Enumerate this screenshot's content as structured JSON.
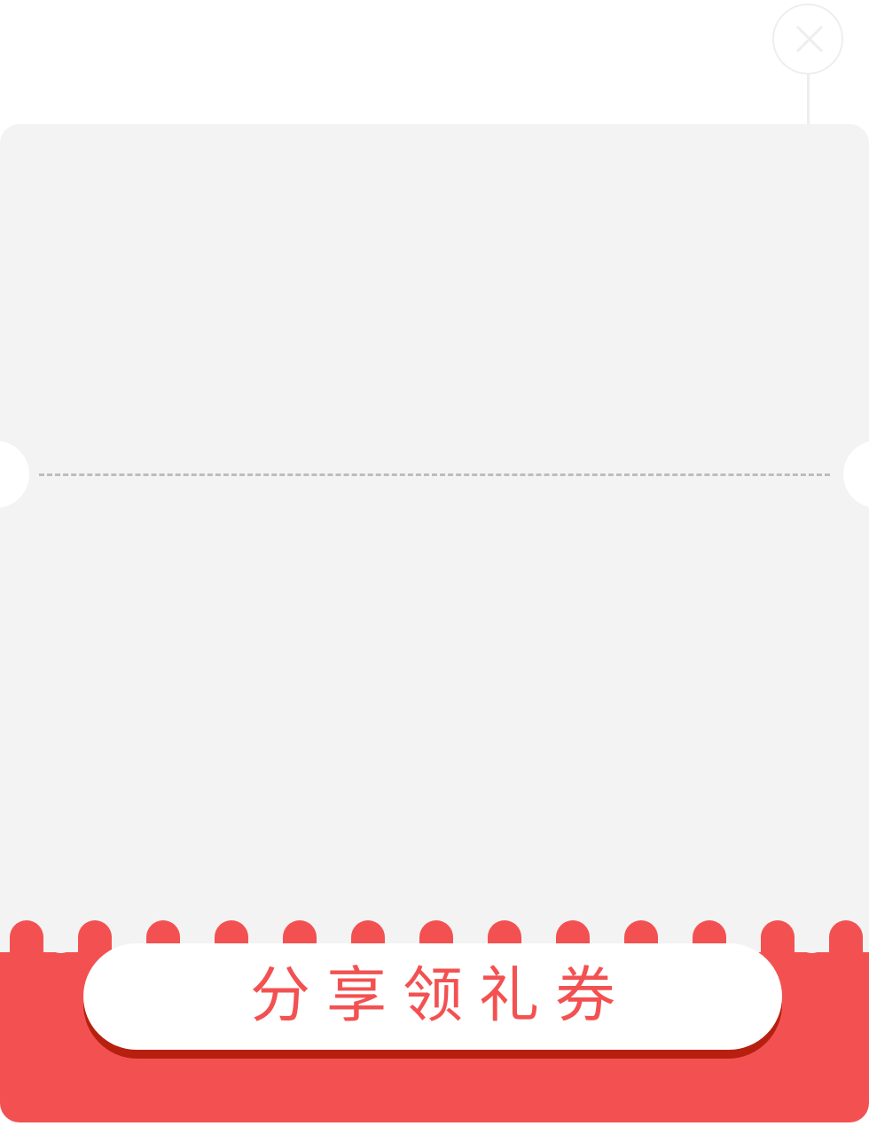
{
  "dialog": {
    "close_icon": "close-icon",
    "share_button_label": "分享领礼券",
    "colors": {
      "accent": "#f35151",
      "button_shadow": "#b7200f",
      "card_background": "#f3f3f3",
      "divider": "#bdbdbd",
      "close_outline": "#eeeeee"
    }
  }
}
